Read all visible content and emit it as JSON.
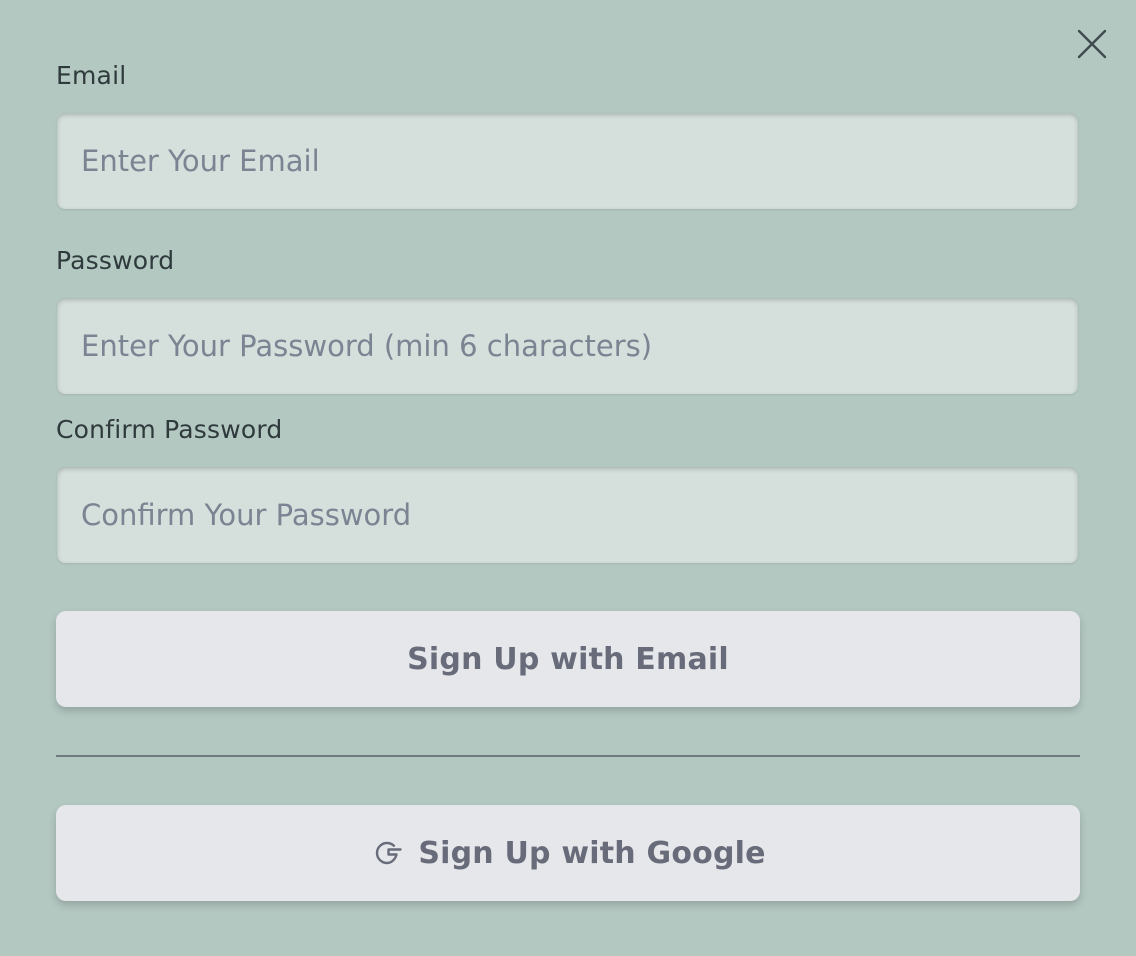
{
  "form": {
    "close_icon": "close-icon",
    "email": {
      "label": "Email",
      "placeholder": "Enter Your Email",
      "value": ""
    },
    "password": {
      "label": "Password",
      "placeholder": "Enter Your Password (min 6 characters)",
      "value": ""
    },
    "confirm_password": {
      "label": "Confirm Password",
      "placeholder": "Confirm Your Password",
      "value": ""
    },
    "email_signup_button": "Sign Up with Email",
    "google_signup_button": "Sign Up with Google",
    "google_icon": "google-icon"
  },
  "colors": {
    "background": "#b4c8c2",
    "input_background": "#d5e0dc",
    "button_background": "#e6e7ea",
    "button_text": "#686c7a",
    "label_text": "#2f3a3c"
  }
}
